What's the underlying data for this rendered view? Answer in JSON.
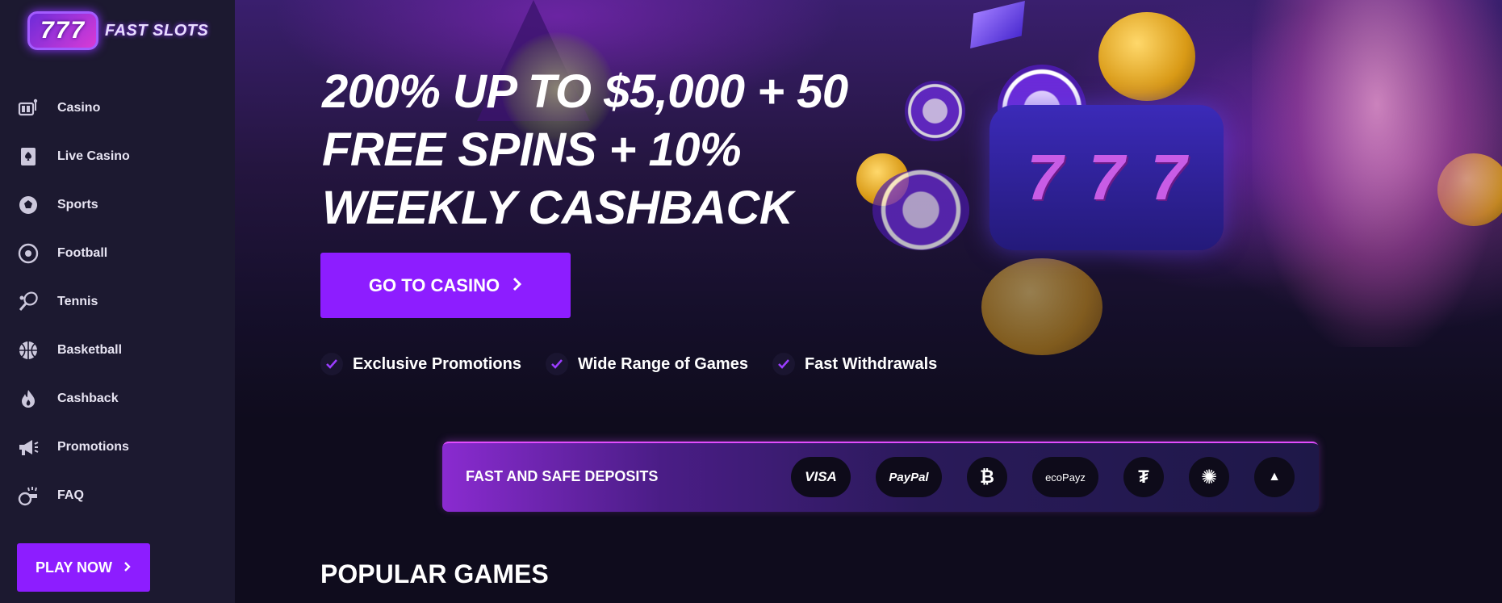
{
  "brand": {
    "logo_number": "777",
    "logo_text": "FAST SLOTS"
  },
  "sidebar": {
    "items": [
      {
        "label": "Casino",
        "icon": "slot-machine-icon"
      },
      {
        "label": "Live Casino",
        "icon": "playing-card-icon"
      },
      {
        "label": "Sports",
        "icon": "soccer-badge-icon"
      },
      {
        "label": "Football",
        "icon": "football-icon"
      },
      {
        "label": "Tennis",
        "icon": "tennis-racket-icon"
      },
      {
        "label": "Basketball",
        "icon": "basketball-icon"
      },
      {
        "label": "Cashback",
        "icon": "flame-icon"
      },
      {
        "label": "Promotions",
        "icon": "megaphone-icon"
      },
      {
        "label": "FAQ",
        "icon": "whistle-icon"
      }
    ],
    "play_now": "PLAY NOW"
  },
  "hero": {
    "headline_lines": [
      "200% UP TO $5,000 + 50",
      "FREE SPINS + 10%",
      "WEEKLY CASHBACK"
    ],
    "cta_label": "GO TO CASINO",
    "reel_symbol": "7",
    "features": [
      "Exclusive Promotions",
      "Wide Range of Games",
      "Fast Withdrawals"
    ]
  },
  "deposits": {
    "title": "FAST AND SAFE DEPOSITS",
    "methods": [
      "VISA",
      "PayPal",
      "₿",
      "ecoPayz",
      "₮",
      "✺",
      "▲"
    ]
  },
  "sections": {
    "popular_title": "POPULAR GAMES"
  },
  "colors": {
    "accent": "#8d1dff",
    "sidebar_bg": "#1c1930",
    "page_bg": "#0f0c1d"
  }
}
